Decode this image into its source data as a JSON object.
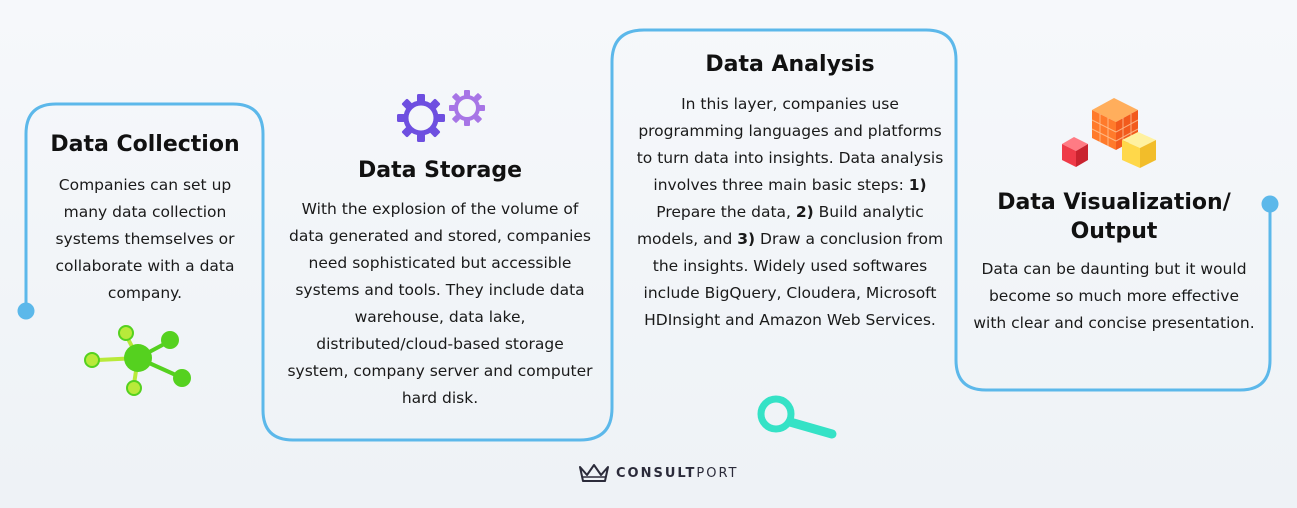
{
  "stages": [
    {
      "title": "Data Collection",
      "description": "Companies can set up many data collection systems themselves or collaborate with a data company.",
      "icon": "network-nodes-icon"
    },
    {
      "title": "Data Storage",
      "description": "With the explosion of the volume of data generated and stored, companies need sophisticated but accessible systems and tools. They include data warehouse, data lake, distributed/cloud-based storage system, company server and computer hard disk.",
      "icon": "gears-icon"
    },
    {
      "title": "Data Analysis",
      "description_parts": [
        "In this layer, companies use programming languages and platforms to turn data into insights. Data analysis involves three main basic steps: ",
        "1)",
        " Prepare the data, ",
        "2)",
        " Build analytic models, and ",
        "3)",
        " Draw a conclusion from the insights. Widely used softwares include BigQuery, Cloudera, Microsoft HDInsight and Amazon Web Services."
      ],
      "icon": "magnifying-glass-icon"
    },
    {
      "title": "Data Visualization/ Output",
      "description": "Data can be daunting but it would become so much more effective with clear and concise presentation.",
      "icon": "cubes-icon"
    }
  ],
  "logo": {
    "bold": "CONSULT",
    "light": "PORT"
  },
  "colors": {
    "connector": "#5cb8ea",
    "purple": "#6e4fe0",
    "violet": "#a775e6",
    "green": "#55d11f",
    "lime": "#b8ea3a",
    "teal": "#35e2c6",
    "orange": "#ff7a2b",
    "red": "#ef3a48",
    "yellow": "#ffd84a"
  }
}
